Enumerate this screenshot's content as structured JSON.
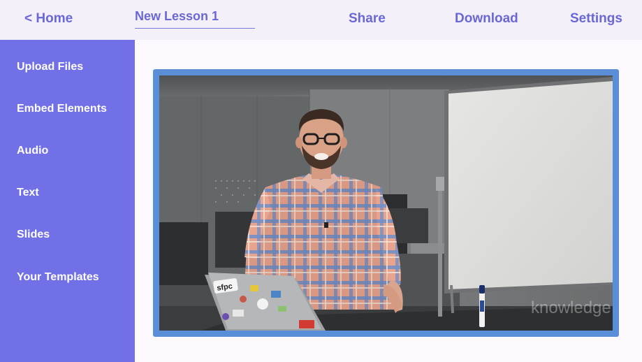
{
  "header": {
    "home_label": "< Home",
    "lesson_title": "New Lesson 1",
    "share_label": "Share",
    "download_label": "Download",
    "settings_label": "Settings"
  },
  "sidebar": {
    "items": [
      {
        "label": "Upload Files"
      },
      {
        "label": "Embed Elements"
      },
      {
        "label": "Audio"
      },
      {
        "label": "Text"
      },
      {
        "label": "Slides"
      },
      {
        "label": "Your Templates"
      }
    ]
  },
  "video": {
    "laptop_sticker": "sfpc",
    "watermark": "knowledge"
  },
  "colors": {
    "accent": "#7170e6",
    "link": "#6a67d6",
    "frame": "#5a8fd8",
    "background": "#faf8fd"
  }
}
